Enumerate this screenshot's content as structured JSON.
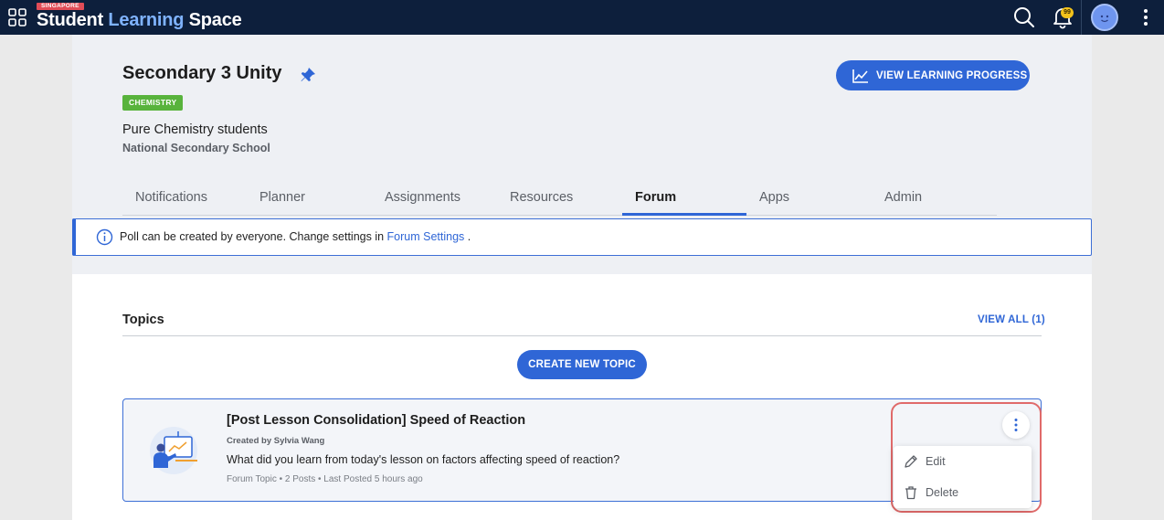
{
  "app": {
    "brand_tag": "SINGAPORE",
    "brand_words": [
      "Student",
      "Learning",
      "Space"
    ],
    "notification_count": "99"
  },
  "class": {
    "title": "Secondary 3 Unity",
    "subject": "CHEMISTRY",
    "description": "Pure Chemistry students",
    "school": "National Secondary School",
    "progress_button": "VIEW LEARNING PROGRESS"
  },
  "tabs": [
    {
      "label": "Notifications",
      "active": false
    },
    {
      "label": "Planner",
      "active": false
    },
    {
      "label": "Assignments",
      "active": false
    },
    {
      "label": "Resources",
      "active": false
    },
    {
      "label": "Forum",
      "active": true
    },
    {
      "label": "Apps",
      "active": false
    },
    {
      "label": "Admin",
      "active": false
    }
  ],
  "banner": {
    "text": "Poll can be created by everyone. Change settings in ",
    "link": "Forum Settings",
    "suffix": " ."
  },
  "topics": {
    "heading": "Topics",
    "view_all": "VIEW ALL (1)",
    "create_button": "CREATE NEW TOPIC",
    "items": [
      {
        "title": "[Post Lesson Consolidation] Speed of Reaction",
        "author": "Created by Sylvia Wang",
        "question": "What did you learn from today's lesson on factors affecting speed of reaction?",
        "meta": "Forum Topic • 2 Posts • Last Posted 5 hours ago"
      }
    ]
  },
  "menu": {
    "items": [
      {
        "label": "Edit",
        "icon": "pencil-icon"
      },
      {
        "label": "Delete",
        "icon": "trash-icon"
      }
    ]
  },
  "colors": {
    "topbar": "#0d1f3c",
    "accent": "#2f66d6",
    "subject_tag": "#58b33c",
    "highlight": "#e06a6a"
  }
}
